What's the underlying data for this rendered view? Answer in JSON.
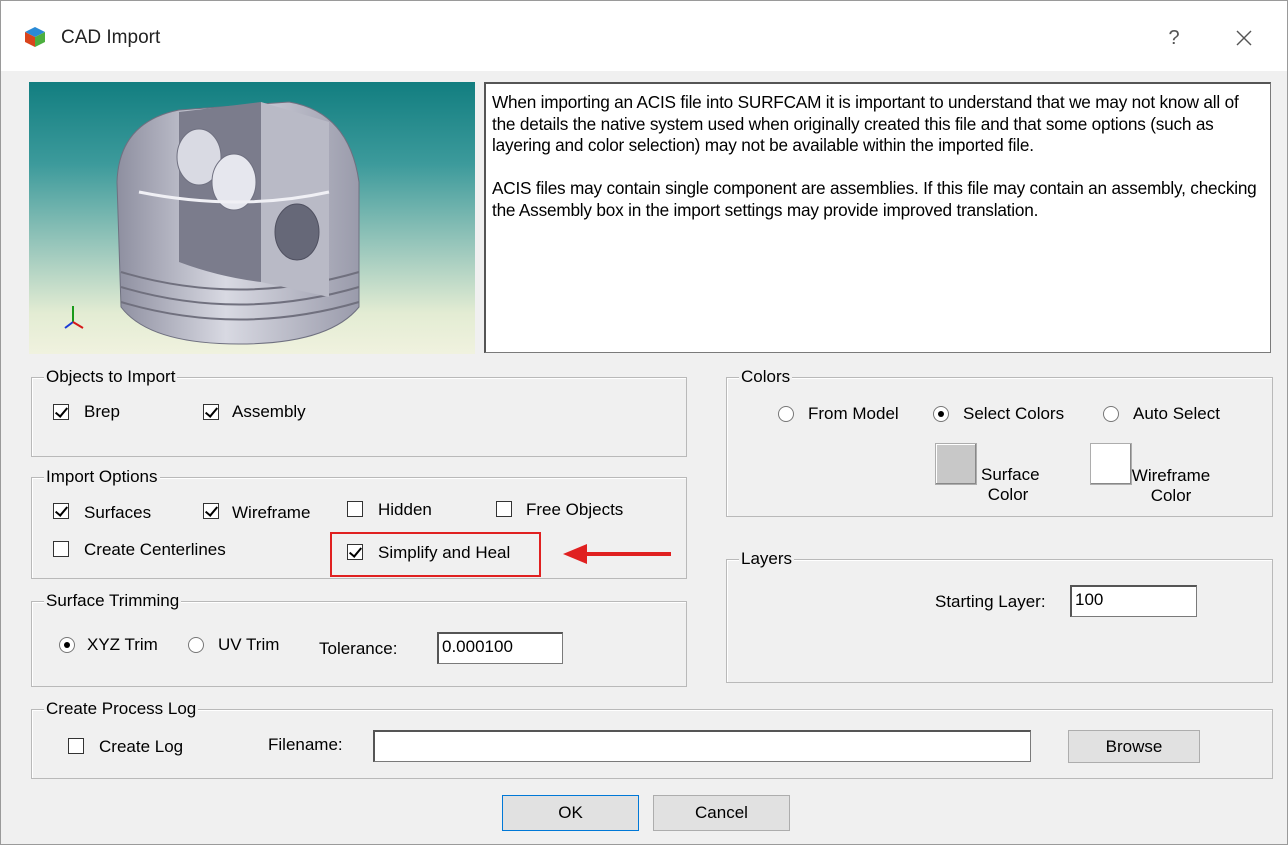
{
  "window": {
    "title": "CAD Import",
    "help_label": "?",
    "close_label": "✕"
  },
  "description": "When importing an ACIS file into SURFCAM it is important to understand that we may not know all of the details the native system used when originally created this file and that some options (such as layering and color selection) may not be available within the imported file.\n\nACIS files may contain single component are assemblies. If this file may contain an assembly, checking the Assembly box in the import settings may provide improved translation.",
  "objects_to_import": {
    "legend": "Objects to Import",
    "brep": {
      "label": "Brep",
      "checked": true
    },
    "assembly": {
      "label": "Assembly",
      "checked": true
    }
  },
  "import_options": {
    "legend": "Import Options",
    "surfaces": {
      "label": "Surfaces",
      "checked": true
    },
    "wireframe": {
      "label": "Wireframe",
      "checked": true
    },
    "hidden": {
      "label": "Hidden",
      "checked": false
    },
    "free_objects": {
      "label": "Free Objects",
      "checked": false
    },
    "create_centerlines": {
      "label": "Create Centerlines",
      "checked": false
    },
    "simplify_heal": {
      "label": "Simplify and Heal",
      "checked": true
    }
  },
  "surface_trimming": {
    "legend": "Surface Trimming",
    "xyz_trim": {
      "label": "XYZ Trim",
      "selected": true
    },
    "uv_trim": {
      "label": "UV Trim",
      "selected": false
    },
    "tolerance_label": "Tolerance:",
    "tolerance_value": "0.000100"
  },
  "process_log": {
    "legend": "Create Process Log",
    "create_log": {
      "label": "Create Log",
      "checked": false
    },
    "filename_label": "Filename:",
    "filename_value": "",
    "browse_label": "Browse"
  },
  "colors": {
    "legend": "Colors",
    "from_model": {
      "label": "From Model",
      "selected": false
    },
    "select_colors": {
      "label": "Select Colors",
      "selected": true
    },
    "auto_select": {
      "label": "Auto Select",
      "selected": false
    },
    "surface_color_label": "Surface\nColor",
    "wireframe_color_label": "Wireframe\nColor",
    "surface_color": "#c8c8c8",
    "wireframe_color": "#ffffff"
  },
  "layers": {
    "legend": "Layers",
    "starting_layer_label": "Starting Layer:",
    "starting_layer_value": "100"
  },
  "buttons": {
    "ok": "OK",
    "cancel": "Cancel"
  },
  "annotation": {
    "highlight_color": "#e02020"
  }
}
